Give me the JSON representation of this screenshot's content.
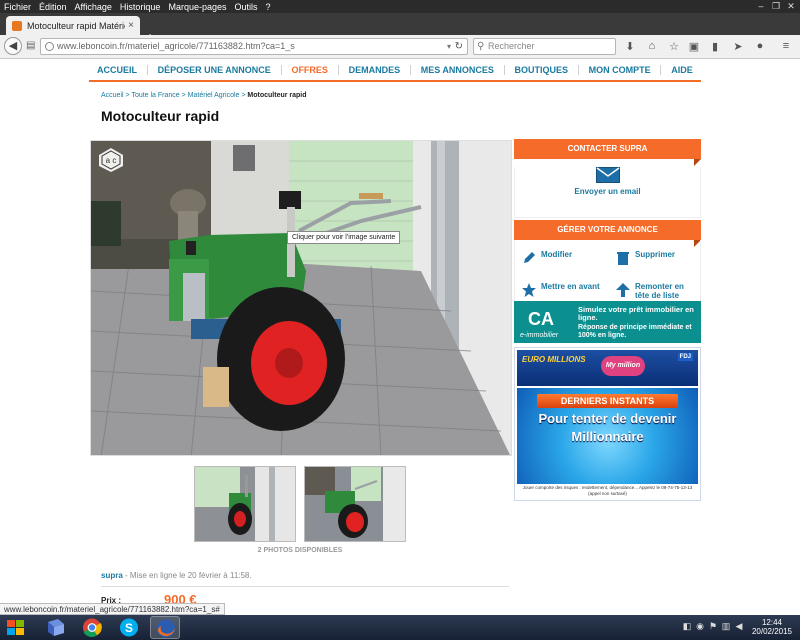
{
  "menubar": {
    "items": [
      "Fichier",
      "Édition",
      "Affichage",
      "Historique",
      "Marque-pages",
      "Outils",
      "?"
    ]
  },
  "browser": {
    "tab_title": "Motoculteur rapid Matériel...",
    "tab_close": "×",
    "new_tab": "+",
    "url": "www.leboncoin.fr/materiel_agricole/771163882.htm?ca=1_s",
    "search_placeholder": "Rechercher"
  },
  "nav": {
    "items": [
      {
        "label": "ACCUEIL",
        "active": false
      },
      {
        "label": "DÉPOSER UNE ANNONCE",
        "active": false
      },
      {
        "label": "OFFRES",
        "active": true
      },
      {
        "label": "DEMANDES",
        "active": false
      },
      {
        "label": "MES ANNONCES",
        "active": false
      },
      {
        "label": "BOUTIQUES",
        "active": false
      },
      {
        "label": "MON COMPTE",
        "active": false
      },
      {
        "label": "AIDE",
        "active": false
      }
    ],
    "accent": "#f56b2a",
    "link": "#1a7aa0"
  },
  "breadcrumb": {
    "home": "Accueil",
    "region": "Toute la France",
    "category": "Matériel Agricole",
    "current": "Motoculteur rapid",
    "sep": " > "
  },
  "ad": {
    "title": "Motoculteur rapid",
    "tooltip": "Cliquer pour voir l'image suivante",
    "photos_count": "2 PHOTOS DISPONIBLES",
    "seller": "supra",
    "posted": " - Mise en ligne le 20 février à 11:58.",
    "price_label": "Prix :",
    "price": "900 €"
  },
  "sidebar": {
    "contact_title": "CONTACTER SUPRA",
    "contact_link": "Envoyer un email",
    "manage_title": "GÉRER VOTRE ANNONCE",
    "actions": {
      "modify": "Modifier",
      "delete": "Supprimer",
      "feature": "Mettre en avant",
      "bump": "Remonter en tête de liste"
    }
  },
  "ads": {
    "ca": {
      "logo": "CA",
      "sub": "e-immobilier",
      "line1": "Simulez votre prêt immobilier en ligne.",
      "line2": "Réponse de principe immédiate et 100% en ligne."
    },
    "em": {
      "logo": "EURO MILLIONS",
      "mymillion": "My million",
      "fdj": "FDJ",
      "banner": "DERNIERS INSTANTS",
      "headline": "Pour tenter de devenir Millionnaire",
      "footer": "Jouer comporte des risques : endettement, dépendance... Appelez le 09-74-75-13-13 (appel non surtaxé)"
    }
  },
  "status": {
    "url": "www.leboncoin.fr/materiel_agricole/771163882.htm?ca=1_s#"
  },
  "taskbar": {
    "time": "12:44",
    "date": "20/02/2015"
  }
}
